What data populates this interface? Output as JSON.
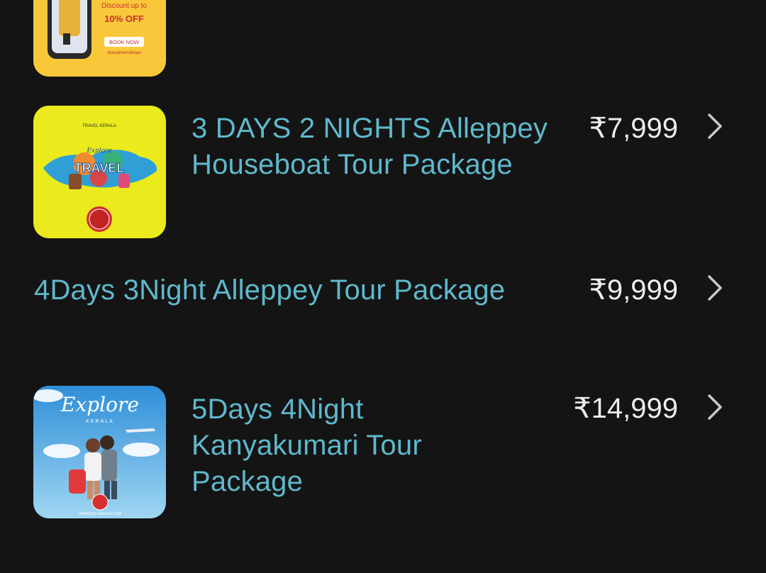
{
  "packages": [
    {
      "promo": {
        "discount_line1": "Discount up to",
        "discount_line2": "10% OFF",
        "cta": "BOOK NOW",
        "tag": "#paradiseholidays"
      }
    },
    {
      "title_lines": [
        "3 DAYS 2 NIGHTS Alleppey",
        "Houseboat Tour Package"
      ],
      "price": "₹7,999",
      "thumb": {
        "header": "TRAVEL KERALA",
        "word": "TRAVEL",
        "sub": "Explore"
      }
    },
    {
      "title_lines": [
        "4Days 3Night Alleppey Tour Package"
      ],
      "price": "₹9,999"
    },
    {
      "title_lines": [
        "5Days 4Night",
        "Kanyakumari Tour",
        "Package"
      ],
      "price": "₹14,999",
      "thumb": {
        "script": "Explore",
        "region": "KERALA",
        "site": "PARADISE-KERALA.COM"
      }
    }
  ],
  "colors": {
    "background": "#141414",
    "title": "#5fb8cc",
    "price": "#ededed",
    "chevron": "#c9c9c9"
  },
  "icons": [
    "chevron-right-icon"
  ]
}
